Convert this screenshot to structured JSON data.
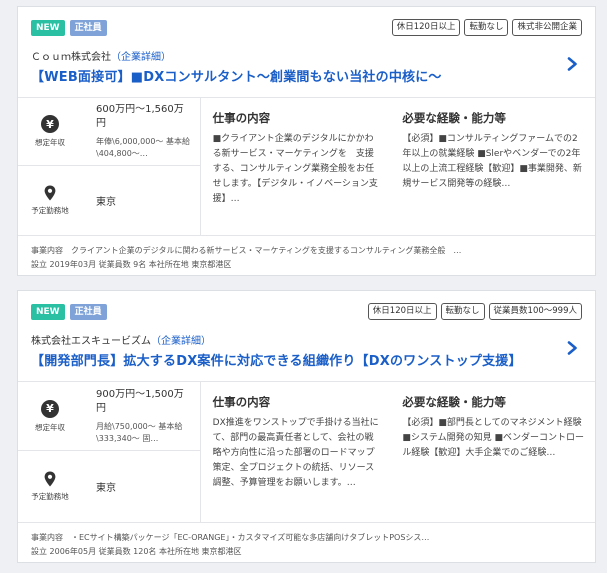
{
  "jobs": [
    {
      "badges": [
        "NEW",
        "正社員"
      ],
      "tags": [
        "休日120日以上",
        "転勤なし",
        "株式非公開企業"
      ],
      "company_name": "Ｃｏｕｍ株式会社",
      "company_link": "（企業詳細）",
      "title": "【WEB面接可】■DXコンサルタント〜創業間もない当社の中核に〜",
      "salary_label": "想定年収",
      "salary": "600万円〜1,560万円",
      "salary_detail": "年俸\\6,000,000〜 基本給\\404,800〜…",
      "location_label": "予定勤務地",
      "location": "東京",
      "work_title": "仕事の内容",
      "work_text": "■クライアント企業のデジタルにかかわる新サービス・マーケティングを　支援する、コンサルティング業務全般をお任せします。【デジタル・イノベーション支援】…",
      "req_title": "必要な経験・能力等",
      "req_text": "【必須】■コンサルティングファームでの2年以上の就業経験 ■Slerやベンダーでの2年以上の上流工程経験【歓迎】■事業開発、新規サービス開発等の経験…",
      "foot_business": "事業内容　クライアント企業のデジタルに関わる新サービス・マーケティングを支援するコンサルティング業務全般　…",
      "foot_info": "設立 2019年03月 従業員数 9名 本社所在地 東京都港区"
    },
    {
      "badges": [
        "NEW",
        "正社員"
      ],
      "tags": [
        "休日120日以上",
        "転勤なし",
        "従業員数100〜999人"
      ],
      "company_name": "株式会社エスキュービズム",
      "company_link": "（企業詳細）",
      "title": "【開発部門長】拡大するDX案件に対応できる組織作り【DXのワンストップ支援】",
      "salary_label": "想定年収",
      "salary": "900万円〜1,500万円",
      "salary_detail": "月給\\750,000〜 基本給\\333,340〜 固…",
      "location_label": "予定勤務地",
      "location": "東京",
      "work_title": "仕事の内容",
      "work_text": "DX推進をワンストップで手掛ける当社にて、部門の最高責任者として、会社の戦略や方向性に沿った部署のロードマップ策定、全プロジェクトの統括、リソース調整、予算管理をお願いします。…",
      "req_title": "必要な経験・能力等",
      "req_text": "【必須】■部門長としてのマネジメント経験 ■システム開発の知見 ■ベンダーコントロール経験【歓迎】大手企業でのご経験…",
      "foot_business": "事業内容　・ECサイト構築パッケージ「EC-ORANGE」・カスタマイズ可能な多店舗向けタブレットPOSシス…",
      "foot_info": "設立 2006年05月 従業員数 120名 本社所在地 東京都港区"
    }
  ],
  "icons": {
    "salary": "yen-icon",
    "location": "map-pin-icon",
    "open": "chevron-right-icon"
  },
  "colors": {
    "accent": "#1a5ec8",
    "new_badge": "#29c0a3",
    "employment_badge": "#7fa3d8"
  }
}
